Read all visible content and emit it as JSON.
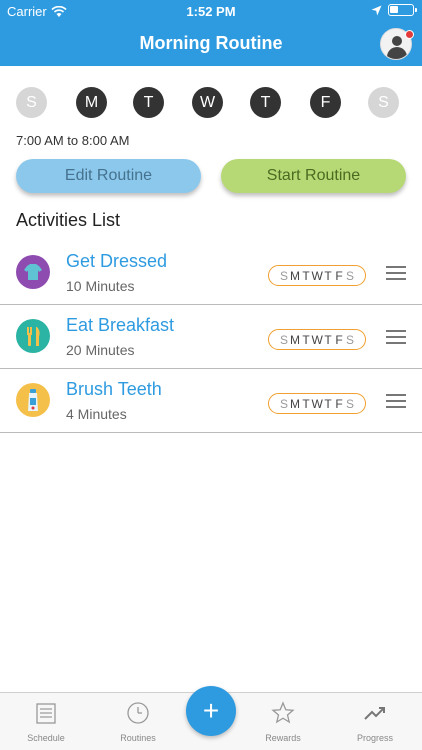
{
  "status_bar": {
    "carrier": "Carrier",
    "time": "1:52 PM"
  },
  "header": {
    "title": "Morning Routine",
    "avatar_icon": "user-avatar-icon",
    "notification_color": "#e23b3b",
    "bar_color": "#2e9be0"
  },
  "days": [
    {
      "label": "S",
      "active": false
    },
    {
      "label": "M",
      "active": true
    },
    {
      "label": "T",
      "active": true
    },
    {
      "label": "W",
      "active": true
    },
    {
      "label": "T",
      "active": true
    },
    {
      "label": "F",
      "active": true
    },
    {
      "label": "S",
      "active": false
    }
  ],
  "time_range": "7:00 AM to 8:00 AM",
  "buttons": {
    "edit": "Edit Routine",
    "start": "Start Routine"
  },
  "list_heading": "Activities List",
  "activities": [
    {
      "name": "Get Dressed",
      "duration": "10 Minutes",
      "icon": "shirt-icon",
      "icon_color": "#8e4bb0",
      "week": [
        "S",
        "M",
        "T",
        "W",
        "T",
        "F",
        "S"
      ]
    },
    {
      "name": "Eat Breakfast",
      "duration": "20 Minutes",
      "icon": "fork-knife-icon",
      "icon_color": "#2bb3a3",
      "week": [
        "S",
        "M",
        "T",
        "W",
        "T",
        "F",
        "S"
      ]
    },
    {
      "name": "Brush Teeth",
      "duration": "4 Minutes",
      "icon": "toothpaste-icon",
      "icon_color": "#f5c04a",
      "week": [
        "S",
        "M",
        "T",
        "W",
        "T",
        "F",
        "S"
      ]
    }
  ],
  "tabbar": {
    "items": [
      {
        "label": "Schedule",
        "icon": "schedule-icon"
      },
      {
        "label": "Routines",
        "icon": "clock-icon"
      },
      {
        "label": "Rewards",
        "icon": "star-icon"
      },
      {
        "label": "Progress",
        "icon": "trend-icon"
      }
    ],
    "fab": "+"
  }
}
